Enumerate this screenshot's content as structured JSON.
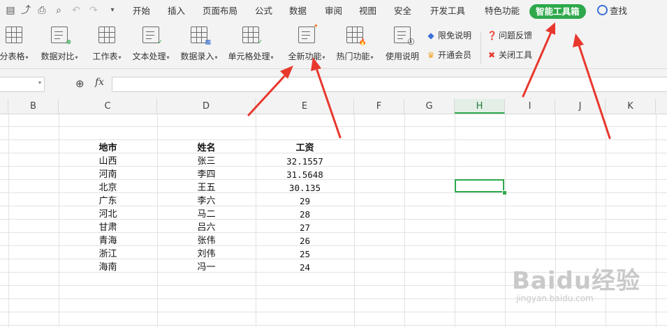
{
  "menu": {
    "tabs": [
      "开始",
      "插入",
      "页面布局",
      "公式",
      "数据",
      "审阅",
      "视图",
      "安全",
      "开发工具",
      "特色功能",
      "智能工具箱"
    ],
    "active_tab": "智能工具箱",
    "search_label": "查找"
  },
  "ribbon": {
    "buttons": [
      {
        "label": "分表格",
        "icon": "split-table-icon"
      },
      {
        "label": "数据对比",
        "icon": "data-compare-icon"
      },
      {
        "label": "工作表",
        "icon": "worksheet-icon"
      },
      {
        "label": "文本处理",
        "icon": "text-process-icon"
      },
      {
        "label": "数据录入",
        "icon": "data-entry-icon"
      },
      {
        "label": "单元格处理",
        "icon": "cell-process-icon"
      },
      {
        "label": "全新功能",
        "icon": "new-feature-icon"
      },
      {
        "label": "热门功能",
        "icon": "hot-feature-icon"
      },
      {
        "label": "使用说明",
        "icon": "help-doc-icon"
      }
    ],
    "small": {
      "free_desc": "限免说明",
      "membership": "开通会员",
      "feedback": "问题反馈",
      "close_tool": "关闭工具"
    }
  },
  "formula_bar": {
    "fx": "fx",
    "value": ""
  },
  "columns": [
    "B",
    "C",
    "D",
    "E",
    "F",
    "G",
    "H",
    "I",
    "J",
    "K"
  ],
  "active_column": "H",
  "table": {
    "headers": [
      "地市",
      "姓名",
      "工资"
    ],
    "rows": [
      [
        "山西",
        "张三",
        "32.1557"
      ],
      [
        "河南",
        "李四",
        "31.5648"
      ],
      [
        "北京",
        "王五",
        "30.135"
      ],
      [
        "广东",
        "李六",
        "29"
      ],
      [
        "河北",
        "马二",
        "28"
      ],
      [
        "甘肃",
        "吕六",
        "27"
      ],
      [
        "青海",
        "张伟",
        "26"
      ],
      [
        "浙江",
        "刘伟",
        "25"
      ],
      [
        "海南",
        "冯一",
        "24"
      ]
    ]
  },
  "watermark": {
    "logo": "Baidu经验",
    "url": "jingyan.baidu.com"
  },
  "colors": {
    "accent": "#2ea84b",
    "arrow": "#e8382e"
  }
}
